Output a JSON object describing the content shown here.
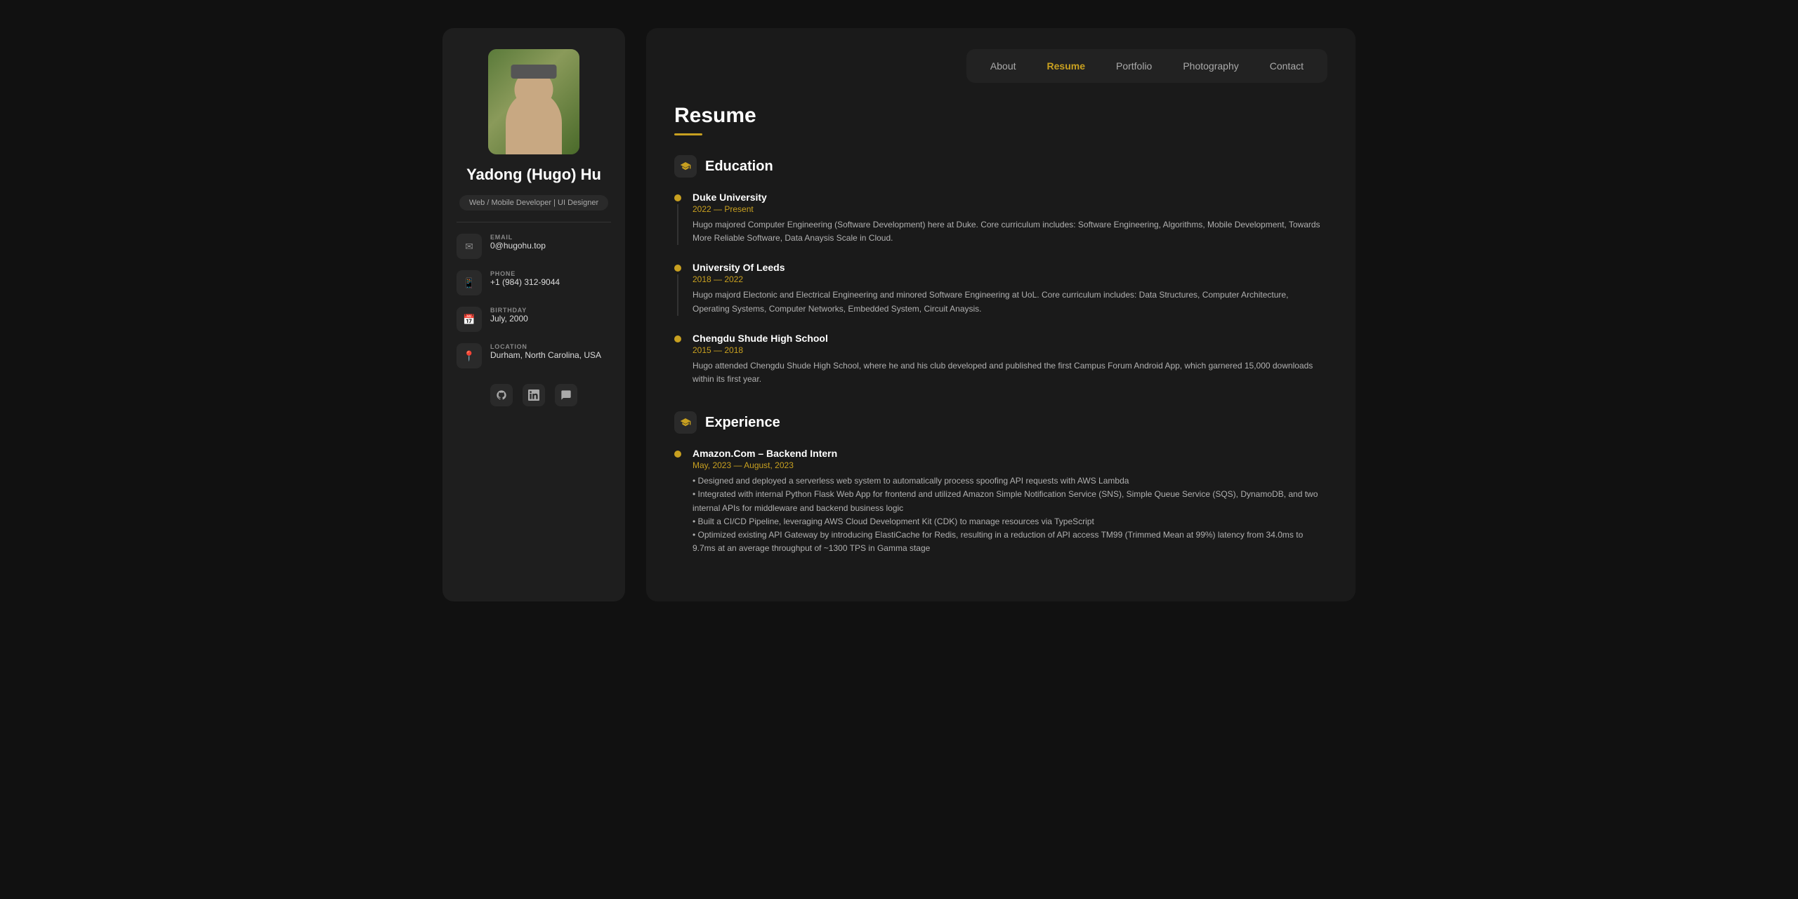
{
  "nav": {
    "items": [
      {
        "label": "About",
        "active": false
      },
      {
        "label": "Resume",
        "active": true
      },
      {
        "label": "Portfolio",
        "active": false
      },
      {
        "label": "Photography",
        "active": false
      },
      {
        "label": "Contact",
        "active": false
      }
    ]
  },
  "sidebar": {
    "name": "Yadong (Hugo) Hu",
    "role": "Web / Mobile Developer | UI Designer",
    "contacts": [
      {
        "label": "EMAIL",
        "value": "0@hugohu.top",
        "icon": "✉"
      },
      {
        "label": "PHONE",
        "value": "+1 (984) 312-9044",
        "icon": "📱"
      },
      {
        "label": "BIRTHDAY",
        "value": "July, 2000",
        "icon": "📅"
      },
      {
        "label": "LOCATION",
        "value": "Durham, North Carolina, USA",
        "icon": "📍"
      }
    ],
    "social": [
      {
        "label": "github-icon",
        "symbol": "⊙"
      },
      {
        "label": "linkedin-icon",
        "symbol": "in"
      },
      {
        "label": "message-icon",
        "symbol": "✉"
      }
    ]
  },
  "resume": {
    "title": "Resume",
    "education": {
      "section_title": "Education",
      "items": [
        {
          "institution": "Duke University",
          "date": "2022 — Present",
          "description": "Hugo majored Computer Engineering (Software Development) here at Duke. Core curriculum includes: Software Engineering, Algorithms, Mobile Development, Towards More Reliable Software, Data Anaysis Scale in Cloud."
        },
        {
          "institution": "University Of Leeds",
          "date": "2018 — 2022",
          "description": "Hugo majord Electonic and Electrical Engineering and minored Software Engineering at UoL. Core curriculum includes: Data Structures, Computer Architecture, Operating Systems, Computer Networks, Embedded System, Circuit Anaysis."
        },
        {
          "institution": "Chengdu Shude High School",
          "date": "2015 — 2018",
          "description": "Hugo attended Chengdu Shude High School, where he and his club developed and published the first Campus Forum Android App, which garnered 15,000 downloads within its first year."
        }
      ]
    },
    "experience": {
      "section_title": "Experience",
      "items": [
        {
          "institution": "Amazon.Com – Backend Intern",
          "date": "May, 2023 — August, 2023",
          "description": "• Designed and deployed a serverless web system to automatically process spoofing API requests with AWS Lambda\n• Integrated with internal Python Flask Web App for frontend and utilized Amazon Simple Notification Service (SNS), Simple Queue Service (SQS), DynamoDB, and two internal APIs for middleware and backend business logic\n• Built a CI/CD Pipeline, leveraging AWS Cloud Development Kit (CDK) to manage resources via TypeScript\n• Optimized existing API Gateway by introducing ElastiCache for Redis, resulting in a reduction of API access TM99 (Trimmed Mean at 99%) latency from 34.0ms to 9.7ms at an average throughput of ~1300 TPS in Gamma stage"
        }
      ]
    }
  },
  "colors": {
    "accent": "#c8a020",
    "bg_dark": "#111111",
    "card_bg": "#1a1a1a",
    "sidebar_bg": "#1e1e1e"
  }
}
